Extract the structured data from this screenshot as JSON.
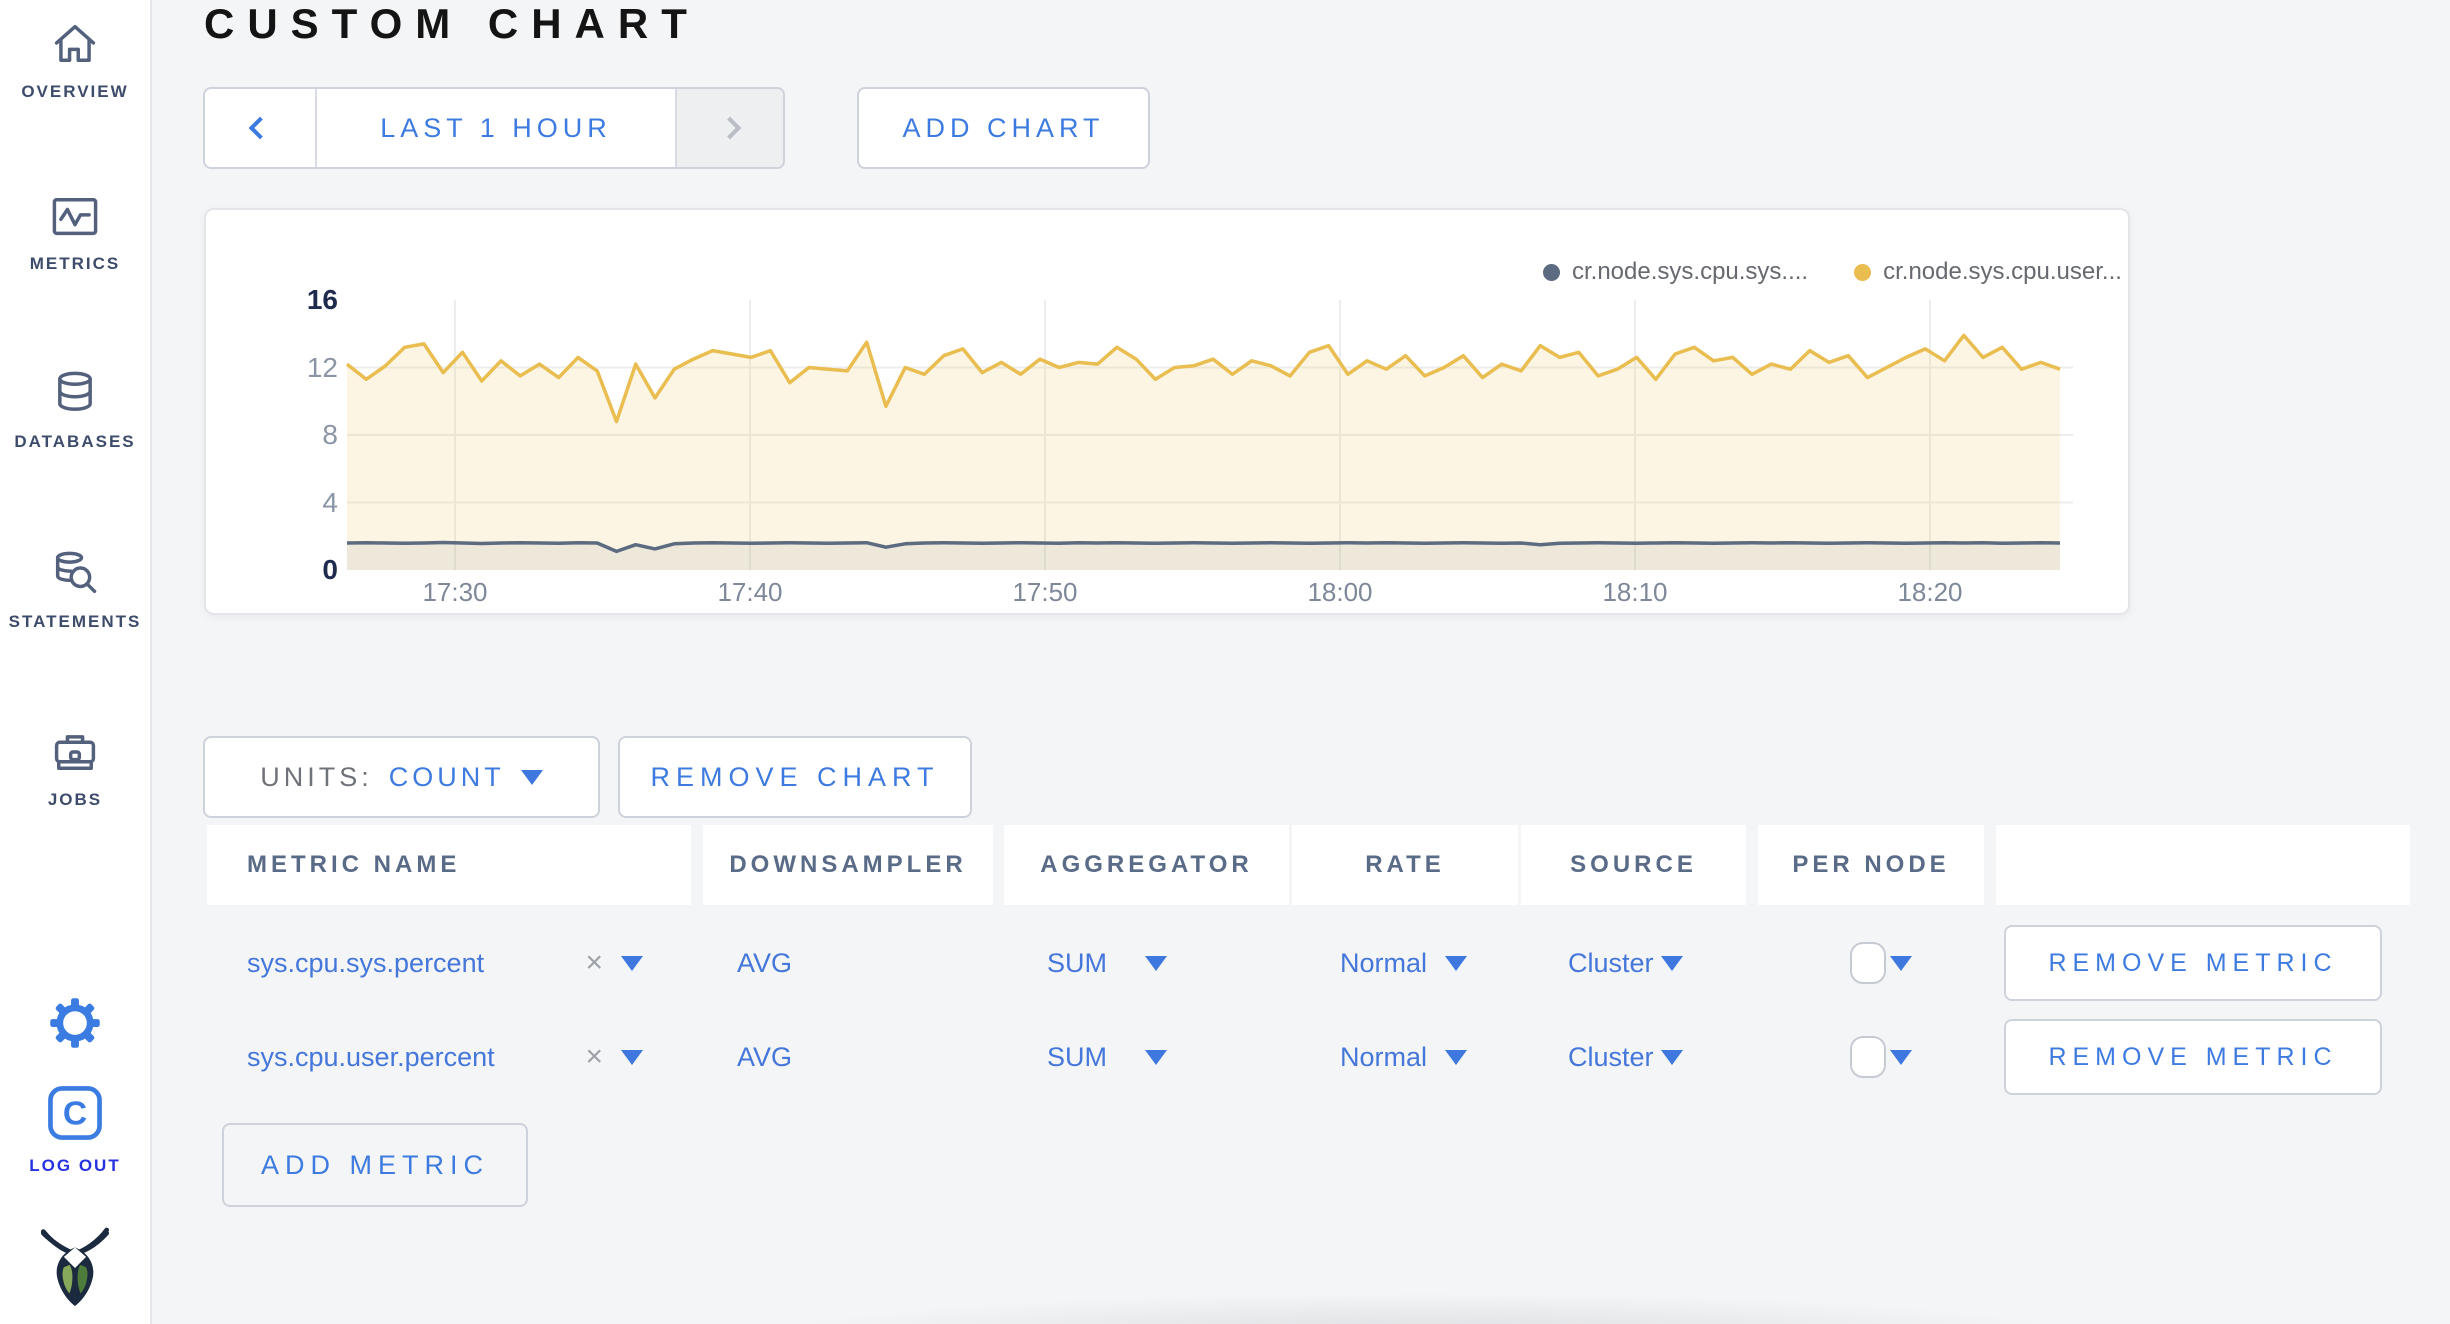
{
  "sidebar": {
    "items": [
      {
        "name": "overview",
        "label": "OVERVIEW"
      },
      {
        "name": "metrics",
        "label": "METRICS"
      },
      {
        "name": "databases",
        "label": "DATABASES"
      },
      {
        "name": "statements",
        "label": "STATEMENTS"
      },
      {
        "name": "jobs",
        "label": "JOBS"
      }
    ],
    "logout_label": "LOG OUT"
  },
  "header": {
    "title": "CUSTOM CHART",
    "time_range": "LAST 1 HOUR",
    "add_chart": "ADD CHART"
  },
  "chart_data": {
    "type": "area",
    "title": "",
    "ylim": [
      0,
      16
    ],
    "yticks": [
      0,
      4,
      8,
      12,
      16
    ],
    "xticklabels": [
      "17:30",
      "17:40",
      "17:50",
      "18:00",
      "18:10",
      "18:20"
    ],
    "grid": true,
    "legend_position": "top-right",
    "series": [
      {
        "name": "cr.node.sys.cpu.sys....",
        "color": "#5C6B80",
        "fill": "rgba(92,107,128,0.09)",
        "values": [
          1.6,
          1.62,
          1.6,
          1.58,
          1.6,
          1.63,
          1.6,
          1.57,
          1.6,
          1.62,
          1.6,
          1.58,
          1.61,
          1.6,
          1.1,
          1.5,
          1.25,
          1.55,
          1.6,
          1.62,
          1.6,
          1.58,
          1.6,
          1.61,
          1.6,
          1.59,
          1.6,
          1.62,
          1.35,
          1.55,
          1.6,
          1.61,
          1.6,
          1.58,
          1.6,
          1.62,
          1.6,
          1.59,
          1.61,
          1.6,
          1.62,
          1.6,
          1.58,
          1.6,
          1.61,
          1.6,
          1.59,
          1.6,
          1.62,
          1.6,
          1.58,
          1.6,
          1.61,
          1.6,
          1.62,
          1.6,
          1.58,
          1.6,
          1.61,
          1.6,
          1.59,
          1.6,
          1.5,
          1.58,
          1.6,
          1.61,
          1.6,
          1.59,
          1.6,
          1.62,
          1.6,
          1.58,
          1.6,
          1.61,
          1.6,
          1.62,
          1.6,
          1.59,
          1.6,
          1.61,
          1.6,
          1.58,
          1.6,
          1.62,
          1.6,
          1.61,
          1.59,
          1.6,
          1.62,
          1.6
        ]
      },
      {
        "name": "cr.node.sys.cpu.user...",
        "color": "#E9BD4F",
        "fill": "rgba(234,190,80,0.16)",
        "values": [
          12.2,
          11.3,
          12.1,
          13.2,
          13.4,
          11.7,
          12.9,
          11.2,
          12.4,
          11.5,
          12.2,
          11.4,
          12.6,
          11.8,
          8.8,
          12.2,
          10.2,
          11.9,
          12.5,
          13.0,
          12.8,
          12.6,
          13.0,
          11.1,
          12.0,
          11.9,
          11.8,
          13.5,
          9.7,
          12.0,
          11.6,
          12.7,
          13.1,
          11.7,
          12.3,
          11.6,
          12.5,
          12.0,
          12.3,
          12.2,
          13.2,
          12.5,
          11.3,
          12.0,
          12.1,
          12.5,
          11.6,
          12.4,
          12.1,
          11.5,
          12.9,
          13.3,
          11.6,
          12.4,
          11.9,
          12.7,
          11.5,
          12.0,
          12.7,
          11.4,
          12.2,
          11.8,
          13.3,
          12.6,
          12.9,
          11.5,
          11.9,
          12.6,
          11.3,
          12.8,
          13.2,
          12.4,
          12.6,
          11.6,
          12.2,
          11.9,
          13.0,
          12.3,
          12.7,
          11.4,
          12.0,
          12.6,
          13.1,
          12.4,
          13.9,
          12.6,
          13.2,
          11.9,
          12.3,
          11.9
        ]
      }
    ]
  },
  "controls": {
    "units_label": "UNITS:",
    "units_value": "COUNT",
    "remove_chart": "REMOVE CHART",
    "add_metric": "ADD METRIC"
  },
  "table": {
    "headers": [
      "METRIC NAME",
      "DOWNSAMPLER",
      "AGGREGATOR",
      "RATE",
      "SOURCE",
      "PER NODE",
      ""
    ],
    "rows": [
      {
        "metric": "sys.cpu.sys.percent",
        "downsampler": "AVG",
        "aggregator": "SUM",
        "rate": "Normal",
        "source": "Cluster",
        "per_node_checked": false,
        "remove_label": "REMOVE METRIC"
      },
      {
        "metric": "sys.cpu.user.percent",
        "downsampler": "AVG",
        "aggregator": "SUM",
        "rate": "Normal",
        "source": "Cluster",
        "per_node_checked": false,
        "remove_label": "REMOVE METRIC"
      }
    ]
  },
  "icons": {
    "clear": "×"
  },
  "colors": {
    "accent_blue": "#3E7BE0",
    "row_blue": "#4577DB",
    "yellow": "#E9BD4F",
    "slate": "#5C6B80",
    "page_bg": "#F4F5F6",
    "logout_blue": "#2633E0"
  }
}
